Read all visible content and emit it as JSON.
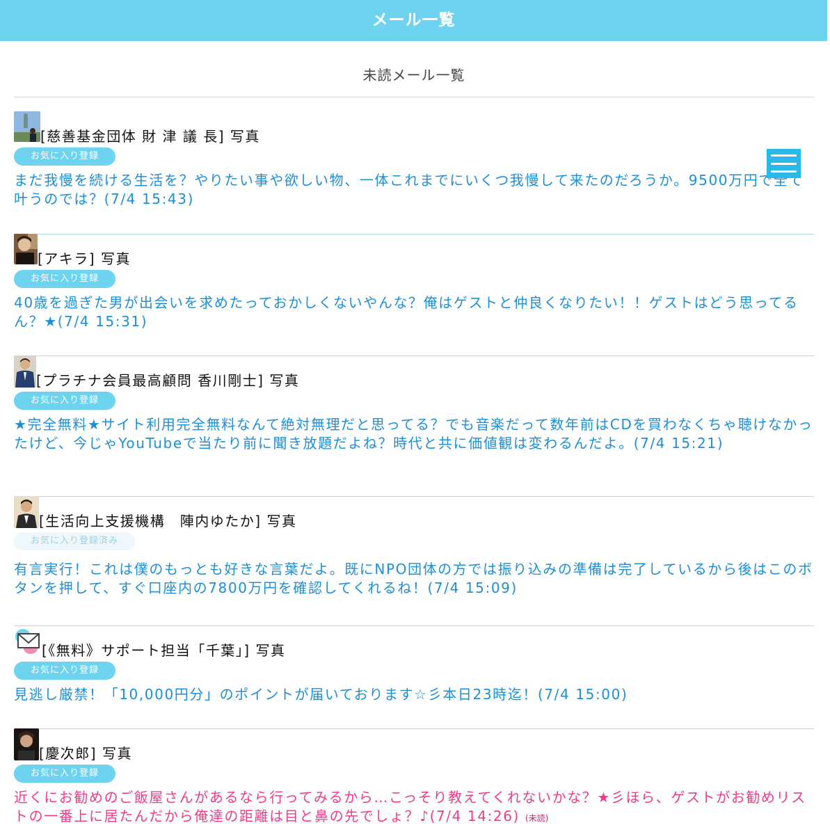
{
  "header": {
    "title": "メール一覧"
  },
  "section": {
    "title": "未読メール一覧"
  },
  "menu": {
    "icon": "hamburger-menu-icon"
  },
  "mails": [
    {
      "sender": "[慈善基金団体 財 津 議 長] 写真",
      "favorite_label": "お気に入り登録",
      "message": "まだ我慢を続ける生活を？やりたい事や欲しい物、一体これまでにいくつ我慢して来たのだろうか。9500万円で全て叶うのでは？(7/4 15:43)"
    },
    {
      "sender": "[アキラ] 写真",
      "favorite_label": "お気に入り登録",
      "message": "40歳を過ぎた男が出会いを求めたっておかしくないやんな？俺はゲストと仲良くなりたい！！ゲストはどう思ってるん？★(7/4 15:31)"
    },
    {
      "sender": "[プラチナ会員最高顧問 香川剛士] 写真",
      "favorite_label": "お気に入り登録",
      "message": "★完全無料★サイト利用完全無料なんて絶対無理だと思ってる？でも音楽だって数年前はCDを買わなくちゃ聴けなかったけど、今じゃYouTubeで当たり前に聞き放題だよね？時代と共に価値観は変わるんだよ。(7/4 15:21)"
    },
    {
      "sender": "[生活向上支援機構　陣内ゆたか] 写真",
      "favorite_label": "お気に入り登録済み",
      "message": "有言実行！これは僕のもっとも好きな言葉だよ。既にNPO団体の方では振り込みの準備は完了しているから後はこのボタンを押して、すぐ口座内の7800万円を確認してくれるね！(7/4 15:09)"
    },
    {
      "sender": "[《無料》サポート担当「千葉」] 写真",
      "favorite_label": "お気に入り登録",
      "message": "見逃し厳禁！「10,000円分」のポイントが届いております☆彡本日23時迄！(7/4 15:00)"
    },
    {
      "sender": "[慶次郎] 写真",
      "favorite_label": "お気に入り登録",
      "message": "近くにお勧めのご飯屋さんがあるなら行ってみるから…こっそり教えてくれないかな？★彡ほら、ゲストがお勧めリストの一番上に居たんだから俺達の距離は目と鼻の先でしょ？♪(7/4 14:26)",
      "unread_label": "(未読)"
    }
  ]
}
